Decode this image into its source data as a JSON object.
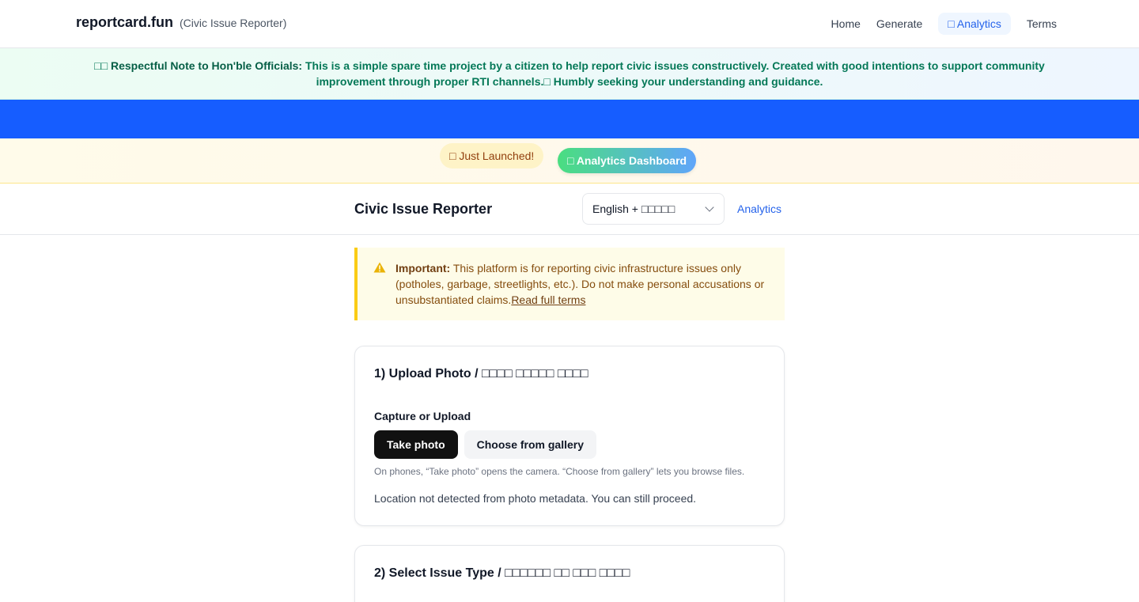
{
  "nav": {
    "brand": "reportcard.fun",
    "brand_sub": "(Civic Issue Reporter)",
    "links": {
      "home": "Home",
      "generate": "Generate",
      "analytics": "□ Analytics",
      "terms": "Terms"
    }
  },
  "note": {
    "prefix": "□□ ",
    "label": "Respectful Note to Hon'ble Officials:",
    "text": " This is a simple spare time project by a citizen to help report civic issues constructively. Created with good intentions to support community improvement through proper RTI channels.□ Humbly seeking your understanding and guidance."
  },
  "launch": {
    "just_launched": "□ Just Launched!",
    "dashboard": "□ Analytics Dashboard"
  },
  "header": {
    "title": "Civic Issue Reporter",
    "language": "English + □□□□□",
    "analytics": "Analytics"
  },
  "notice": {
    "label": "Important:",
    "text": " This platform is for reporting civic infrastructure issues only (potholes, garbage, streetlights, etc.). Do not make personal accusations or unsubstantiated claims.",
    "link": "Read full terms"
  },
  "upload": {
    "title": "1) Upload Photo / □□□□ □□□□□ □□□□",
    "label": "Capture or Upload",
    "take_photo": "Take photo",
    "gallery": "Choose from gallery",
    "hint": "On phones, “Take photo” opens the camera. “Choose from gallery” lets you browse files.",
    "location": "Location not detected from photo metadata. You can still proceed."
  },
  "issue": {
    "title": "2) Select Issue Type / □□□□□□ □□ □□□ □□□□"
  },
  "colors": {
    "brand_blue": "#165dff",
    "link_blue": "#2563eb",
    "warning_yellow": "#facc15",
    "dark_button": "#111111"
  }
}
